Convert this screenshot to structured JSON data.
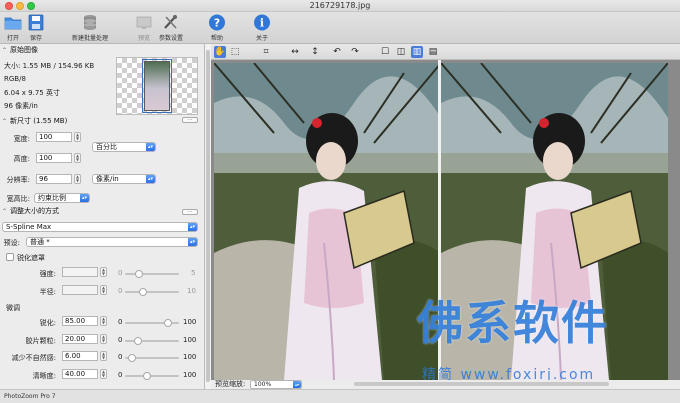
{
  "window": {
    "title": "216729178.jpg"
  },
  "toolbar": {
    "open": "打开",
    "save": "保存",
    "batch": "新建批量处理",
    "preview": "预览",
    "params": "参数设置",
    "help": "帮助",
    "about": "关于"
  },
  "original": {
    "header": "原始图像",
    "size": "大小: 1.55 MB / 154.96 KB",
    "mode": "RGB/8",
    "dims": "6.04 x 9.75 英寸",
    "res": "96 像素/in",
    "more": "..."
  },
  "newsize": {
    "header": "新尺寸 (1.55 MB)",
    "more": "...",
    "width_label": "宽度:",
    "width_value": "100",
    "height_label": "高度:",
    "height_value": "100",
    "unit": "百分比",
    "res_label": "分辨率:",
    "res_value": "96",
    "res_unit": "像素/in",
    "ratio_label": "宽高比:",
    "ratio_value": "约束比例"
  },
  "method": {
    "header": "调整大小的方式",
    "more": "...",
    "algorithm": "S-Spline Max",
    "preset_label": "预设:",
    "preset_value": "普通 *",
    "unsharp_label": "锐化遮罩",
    "strength_label": "强度:",
    "strength_min": "0",
    "strength_max": "5",
    "radius_label": "半径:",
    "radius_min": "0",
    "radius_max": "10",
    "finetune_label": "微调",
    "sharp_label": "锐化:",
    "sharp_value": "85.00",
    "sharp_level": 0.85,
    "film_label": "胶片颗粒:",
    "film_value": "20.00",
    "film_level": 0.2,
    "artifact_label": "减少不自然感:",
    "artifact_value": "6.00",
    "artifact_level": 0.06,
    "clarity_label": "清晰度:",
    "clarity_value": "40.00",
    "clarity_level": 0.4,
    "min": "0",
    "max": "100"
  },
  "status": {
    "app": "PhotoZoom Pro 7"
  },
  "view": {
    "zoom_label": "预览缩放:",
    "zoom_value": "100%"
  },
  "watermark": {
    "main": "佛系软件",
    "sub": "精简 www.foxirj.com"
  }
}
